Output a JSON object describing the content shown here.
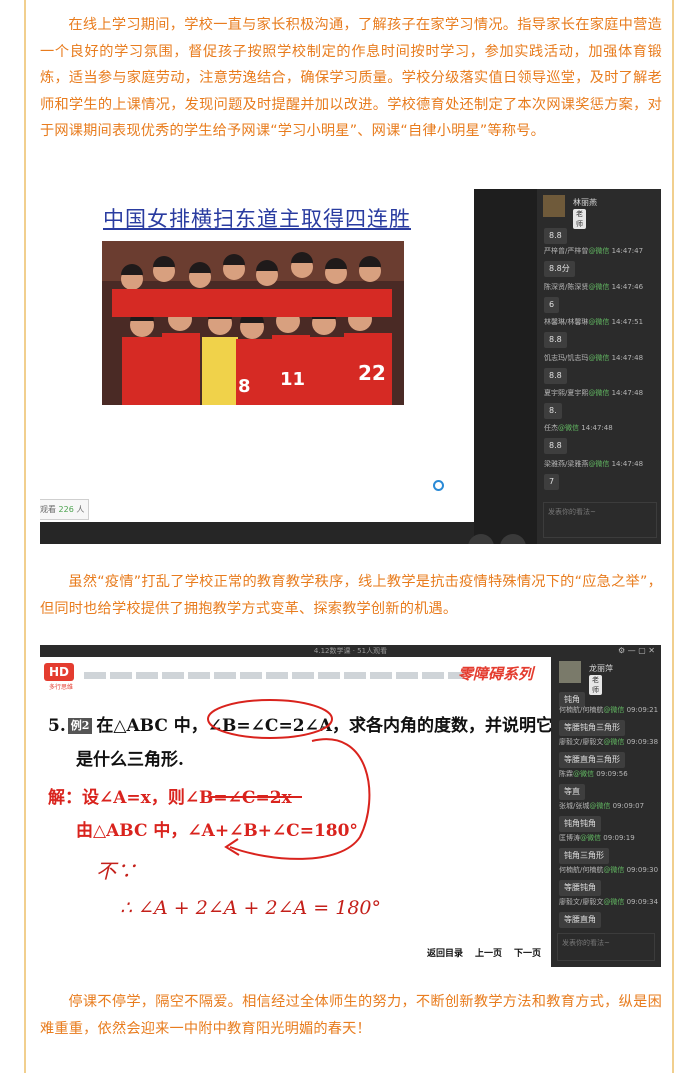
{
  "article": {
    "paragraph1": "在线上学习期间，学校一直与家长积极沟通，了解孩子在家学习情况。指导家长在家庭中营造一个良好的学习氛围，督促孩子按照学校制定的作息时间按时学习，参加实践活动，加强体育锻炼，适当参与家庭劳动，注意劳逸结合，确保学习质量。学校分级落实值日领导巡堂，及时了解老师和学生的上课情况，发现问题及时提醒并加以改进。学校德育处还制定了本次网课奖惩方案，对于网课期间表现优秀的学生给予网课“学习小明星”、网课“自律小明星”等称号。",
    "paragraph2": "虽然“疫情”打乱了学校正常的教育教学秩序，线上教学是抗击疫情特殊情况下的“应急之举”，但同时也给学校提供了拥抱教学方式变革、探索教学创新的机遇。",
    "paragraph3": "停课不停学，隔空不隔爱。相信经过全体师生的努力，不断创新教学方法和教育方式，纵是困难重重，依然会迎来一中附中教育阳光明媚的春天！"
  },
  "screenshot1": {
    "slide_title": "中国女排横扫东道主取得四连胜",
    "jersey_numbers": [
      "8",
      "11",
      "22"
    ],
    "viewer_count_prefix": "观看",
    "viewer_count": "226",
    "viewer_count_suffix": "人",
    "teacher_name": "林丽燕",
    "teacher_tag": "老师",
    "messages": [
      {
        "meta": "",
        "src": "",
        "time": "",
        "body": "8.8"
      },
      {
        "meta": "严梓曾/严梓曾",
        "src": "@微信",
        "time": "14:47:47",
        "body": "8.8分"
      },
      {
        "meta": "陈深贤/陈深贤",
        "src": "@微信",
        "time": "14:47:46",
        "body": "6"
      },
      {
        "meta": "林馨琳/林馨琳",
        "src": "@微信",
        "time": "14:47:51",
        "body": "8.8"
      },
      {
        "meta": "饥志玛/饥志玛",
        "src": "@微信",
        "time": "14:47:48",
        "body": "8.8"
      },
      {
        "meta": "夏宇熙/夏宇熙",
        "src": "@微信",
        "time": "14:47:48",
        "body": "8."
      },
      {
        "meta": "任杰",
        "src": "@微信",
        "time": "14:47:48",
        "body": "8.8"
      },
      {
        "meta": "梁雅燕/梁雅燕",
        "src": "@微信",
        "time": "14:47:48",
        "body": "7"
      }
    ],
    "input_placeholder": "发表你的看法~"
  },
  "screenshot2": {
    "window_title": "4.12数学课 · 51人观看",
    "logo_text": "HD",
    "logo_subtext": "多行思维",
    "series_label": "零障碍系列",
    "question_number": "5.",
    "question_tag": "例2",
    "question_line1_a": "在△ABC 中，",
    "question_line1_b": "∠B=∠C=2∠A",
    "question_line1_c": "，求各内角的度数，并说明它",
    "question_line2": "是什么三角形.",
    "solution_label": "解：",
    "solution_line1": "设∠A=x，则∠B=∠C=2x",
    "solution_line2": "由△ABC 中，∠A+∠B+∠C=180°",
    "handwriting_1": "不∵",
    "handwriting_2": "∴  ∠A + 2∠A + 2∠A = 180°",
    "nav_catalog": "返回目录",
    "nav_prev": "上一页",
    "nav_next": "下一页",
    "teacher_name": "龙丽萍",
    "teacher_tag": "老师",
    "messages": [
      {
        "meta": "",
        "src": "",
        "time": "",
        "body": "钝角"
      },
      {
        "meta": "何楠航/何楠航",
        "src": "@微信",
        "time": "09:09:21",
        "body": "等腰钝角三角形"
      },
      {
        "meta": "廖毅文/廖毅文",
        "src": "@微信",
        "time": "09:09:38",
        "body": "等腰直角三角形"
      },
      {
        "meta": "陈霖",
        "src": "@微信",
        "time": "09:09:56",
        "body": "等直"
      },
      {
        "meta": "张城/张城",
        "src": "@微信",
        "time": "09:09:07",
        "body": "钝角钝角"
      },
      {
        "meta": "匡博涛",
        "src": "@微信",
        "time": "09:09:19",
        "body": "钝角三角形"
      },
      {
        "meta": "何楠航/何楠航",
        "src": "@微信",
        "time": "09:09:30",
        "body": "等腰钝角"
      },
      {
        "meta": "廖毅文/廖毅文",
        "src": "@微信",
        "time": "09:09:34",
        "body": "等腰直角"
      }
    ],
    "input_placeholder": "发表你的看法~"
  }
}
